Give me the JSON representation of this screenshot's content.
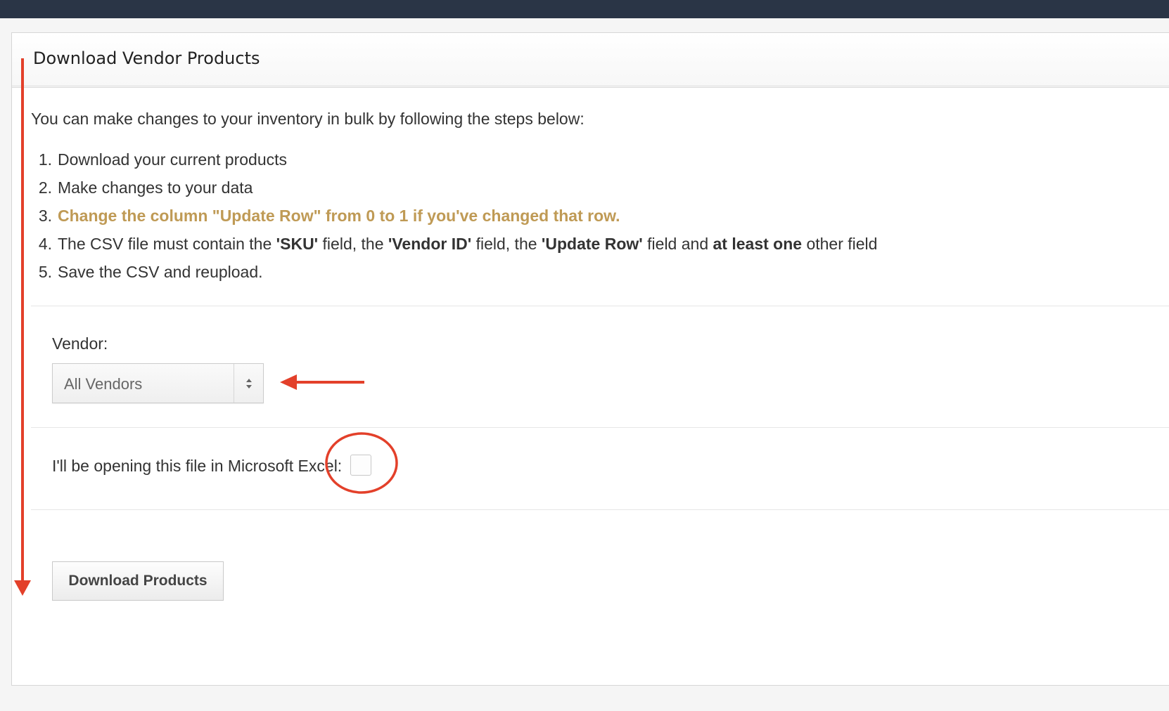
{
  "panel": {
    "title": "Download Vendor Products"
  },
  "intro": "You can make changes to your inventory in bulk by following the steps below:",
  "steps": [
    {
      "num": "1.",
      "text": "Download your current products"
    },
    {
      "num": "2.",
      "text": "Make changes to your data"
    },
    {
      "num": "3.",
      "text": "Change the column \"Update Row\" from 0 to 1 if you've changed that row."
    },
    {
      "num": "4.",
      "parts": [
        "The CSV file must contain the ",
        "'SKU'",
        " field, the ",
        "'Vendor ID'",
        " field, the ",
        "'Update Row'",
        " field and ",
        "at least one",
        " other field"
      ]
    },
    {
      "num": "5.",
      "text": "Save the CSV and reupload."
    }
  ],
  "vendor": {
    "label": "Vendor:",
    "selected": "All Vendors"
  },
  "excel": {
    "label": "I'll be opening this file in Microsoft Excel:",
    "checked": false
  },
  "download_button": "Download Products",
  "colors": {
    "topbar": "#2a3546",
    "highlight": "#bf9a55",
    "annotation": "#e3402a"
  },
  "icons": {
    "select_arrows": "up-down-caret-icon"
  }
}
